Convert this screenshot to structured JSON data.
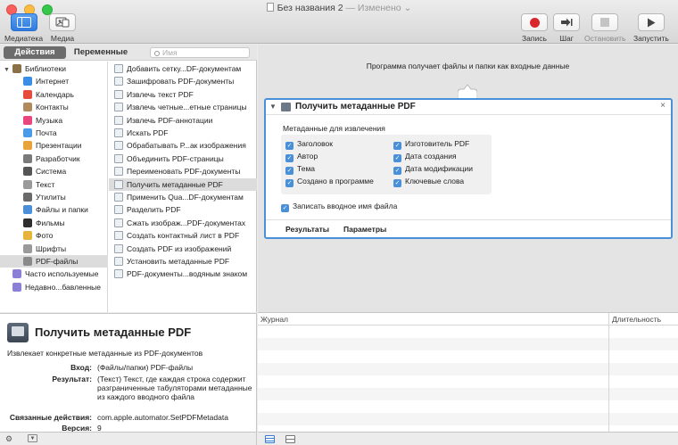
{
  "window": {
    "title": "Без названия 2",
    "status": "— Изменено",
    "chevron": "⌄"
  },
  "toolbar": {
    "library_label": "Медиатека",
    "media_label": "Медиа",
    "record_label": "Запись",
    "step_label": "Шаг",
    "stop_label": "Остановить",
    "run_label": "Запустить"
  },
  "library": {
    "tabs": [
      "Действия",
      "Переменные"
    ],
    "search_placeholder": "Имя",
    "categories": [
      {
        "label": "Библиотеки",
        "color": "#8b6f47"
      },
      {
        "label": "Интернет",
        "color": "#3a8ee6"
      },
      {
        "label": "Календарь",
        "color": "#e64b3b"
      },
      {
        "label": "Контакты",
        "color": "#b08a5a"
      },
      {
        "label": "Музыка",
        "color": "#e8467c"
      },
      {
        "label": "Почта",
        "color": "#4a9be8"
      },
      {
        "label": "Презентации",
        "color": "#e8a33a"
      },
      {
        "label": "Разработчик",
        "color": "#7a7a7a"
      },
      {
        "label": "Система",
        "color": "#555555"
      },
      {
        "label": "Текст",
        "color": "#9a9a9a"
      },
      {
        "label": "Утилиты",
        "color": "#6a6a6a"
      },
      {
        "label": "Файлы и папки",
        "color": "#4a8fd8"
      },
      {
        "label": "Фильмы",
        "color": "#2e2e2e"
      },
      {
        "label": "Фото",
        "color": "#e8b33a"
      },
      {
        "label": "Шрифты",
        "color": "#9a9a9a"
      },
      {
        "label": "PDF-файлы",
        "color": "#8a8a8a"
      },
      {
        "label": "Часто используемые",
        "color": "#8c7fd6"
      },
      {
        "label": "Недавно...бавленные",
        "color": "#8c7fd6"
      }
    ],
    "actions": [
      "Добавить сетку...DF-документам",
      "Зашифровать PDF-документы",
      "Извлечь текст PDF",
      "Извлечь четные...етные страницы",
      "Извлечь PDF-аннотации",
      "Искать PDF",
      "Обрабатывать Р...ак изображения",
      "Объединить PDF-страницы",
      "Переименовать PDF-документы",
      "Получить метаданные PDF",
      "Применить Qua...DF-документам",
      "Разделить PDF",
      "Сжать изображ...PDF-документах",
      "Создать контактный лист в PDF",
      "Создать PDF из изображений",
      "Установить метаданные PDF",
      "PDF-документы...водяным знаком"
    ]
  },
  "description": {
    "title": "Получить метаданные PDF",
    "subtitle": "Извлекает конкретные метаданные из PDF-документов",
    "input_key": "Вход:",
    "input_val": "(Файлы/папки) PDF-файлы",
    "result_key": "Результат:",
    "result_val": "(Текст) Текст, где каждая строка содержит разграниченные табуляторами метаданные из каждого вводного файла",
    "related_key": "Связанные действия:",
    "related_val": "com.apple.automator.SetPDFMetadata",
    "version_key": "Версия:",
    "version_val": "9"
  },
  "workflow": {
    "input_note": "Программа получает файлы и папки как входные данные",
    "card_title": "Получить метаданные PDF",
    "close_glyph": "×",
    "meta_label": "Метаданные для извлечения",
    "checkboxes": [
      "Заголовок",
      "Автор",
      "Тема",
      "Создано в программе",
      "Изготовитель PDF",
      "Дата создания",
      "Дата модификации",
      "Ключевые слова"
    ],
    "write_input_name": "Записать вводное имя файла",
    "tab_results": "Результаты",
    "tab_params": "Параметры"
  },
  "log": {
    "col_journal": "Журнал",
    "col_duration": "Длительность"
  }
}
